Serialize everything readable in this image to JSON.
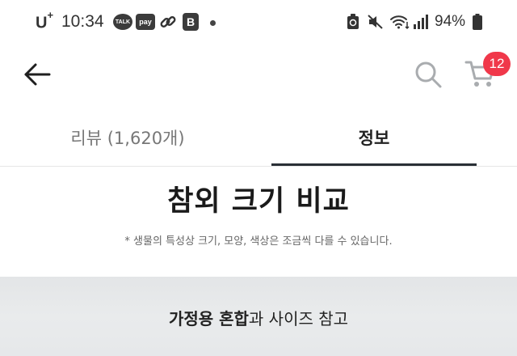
{
  "status_bar": {
    "carrier": "U",
    "carrier_sup": "+",
    "time": "10:34",
    "talk_icon_text": "TALK",
    "pay_icon_text": "pay",
    "b_icon_text": "B",
    "battery_percent": "94%"
  },
  "header": {
    "back_icon": "arrow-left-icon",
    "search_icon": "search-icon",
    "cart_icon": "cart-icon",
    "cart_count": "12"
  },
  "tabs": [
    {
      "label": "리뷰 (1,620개)",
      "selected": false
    },
    {
      "label": "정보",
      "selected": true
    }
  ],
  "content": {
    "title": "참외 크기 비교",
    "note": "* 생물의 특성상 크기, 모양, 색상은 조금씩 다를 수 있습니다.",
    "caption_bold": "가정용 혼합",
    "caption_rest": "과 사이즈 참고"
  },
  "colors": {
    "badge": "#f0384a",
    "tab_underline": "#2a2f36",
    "inactive_tab": "#777777"
  }
}
